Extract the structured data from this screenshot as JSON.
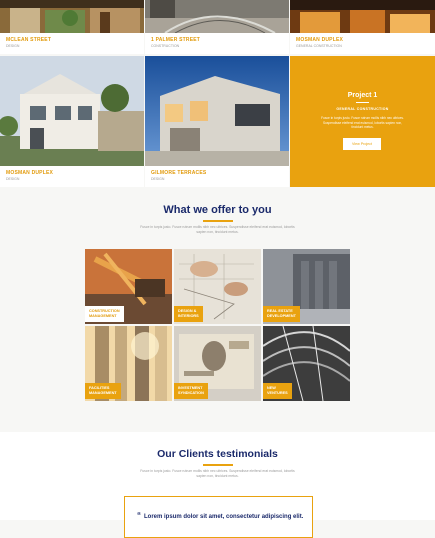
{
  "projects": [
    {
      "title": "MCLEAN STREET",
      "subtitle": "DESIGN"
    },
    {
      "title": "1 PALMER STREET",
      "subtitle": "CONSTRUCTION"
    },
    {
      "title": "MOSMAN DUPLEX",
      "subtitle": "GENERAL CONSTRUCTION"
    },
    {
      "title": "MOSMAN DUPLEX",
      "subtitle": "DESIGN"
    },
    {
      "title": "GILMORE TERRACES",
      "subtitle": "DESIGN"
    }
  ],
  "featured": {
    "title": "Project 1",
    "category": "GENERAL CONSTRUCTION",
    "description": "Fusce in turpis justo. Fusce rutrum mollis nibh nec ultrices. Suspendisse eleifend erat euismod, lobortis sapien non, tincidunt metus.",
    "button": "View Project"
  },
  "offer": {
    "heading": "What we offer to you",
    "text": "Fusce in turpis justo. Fusce rutrum mollis nibh nec ultrices. Suspendisse eleifend erat euismod, lobortis sapien non, tincidunt metus.",
    "tiles": [
      {
        "line1": "CONSTRUCTION",
        "line2": "MANAGEMENT"
      },
      {
        "line1": "DESIGN &",
        "line2": "INTERIORS"
      },
      {
        "line1": "REAL ESTATE",
        "line2": "DEVELOPMENT"
      },
      {
        "line1": "FACILITIES",
        "line2": "MANAGEMENT"
      },
      {
        "line1": "INVESTMENT",
        "line2": "SYNDICATION"
      },
      {
        "line1": "NEW",
        "line2": "VENTURES"
      }
    ]
  },
  "testimonials": {
    "heading": "Our Clients testimonials",
    "text": "Fusce in turpis justo. Fusce rutrum mollis nibh nec ultrices. Suspendisse eleifend erat euismod, lobortis sapien non, tincidunt metus.",
    "quote": "Lorem ipsum dolor sit amet, consectetur adipiscing elit."
  },
  "colors": {
    "accent": "#e9a20f",
    "navy": "#1b2a6b"
  }
}
